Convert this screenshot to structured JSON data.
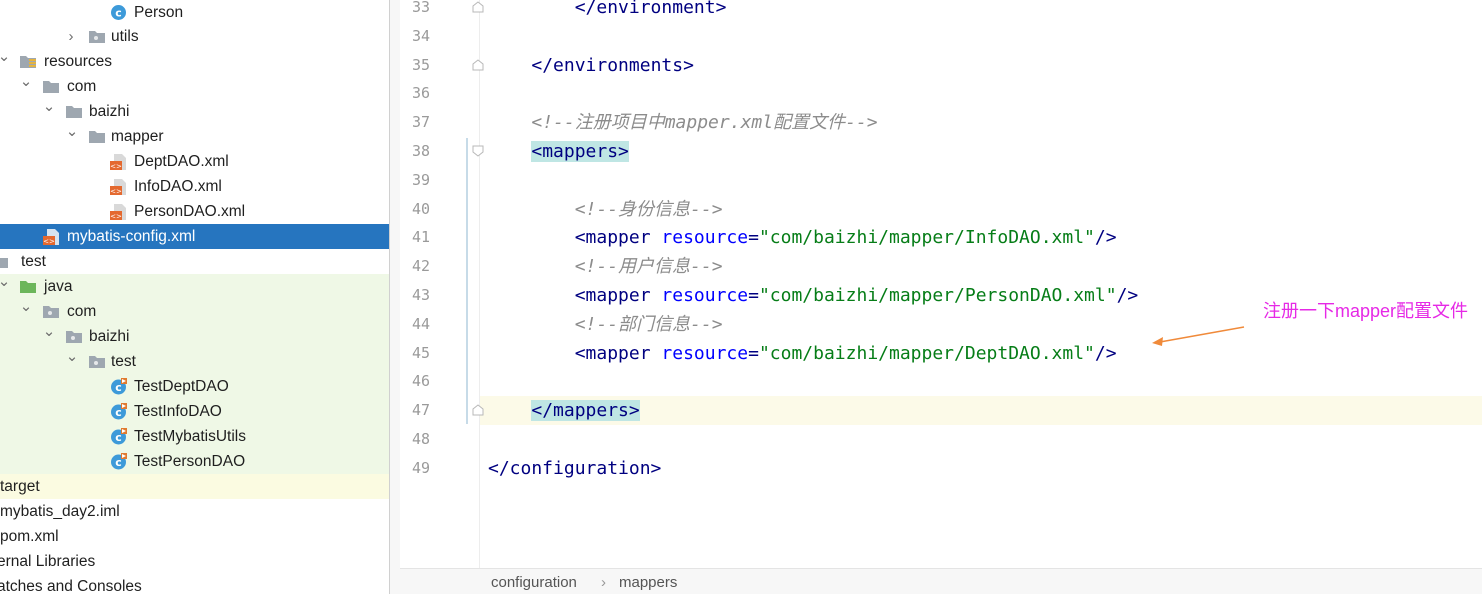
{
  "project_tree": {
    "items": [
      {
        "label": "Person",
        "icon": "class-icon"
      },
      {
        "label": "utils",
        "icon": "package-folder-icon"
      },
      {
        "label": "resources",
        "icon": "resources-folder-icon"
      },
      {
        "label": "com",
        "icon": "folder-icon"
      },
      {
        "label": "baizhi",
        "icon": "folder-icon"
      },
      {
        "label": "mapper",
        "icon": "folder-icon"
      },
      {
        "label": "DeptDAO.xml",
        "icon": "xml-file-icon"
      },
      {
        "label": "InfoDAO.xml",
        "icon": "xml-file-icon"
      },
      {
        "label": "PersonDAO.xml",
        "icon": "xml-file-icon"
      },
      {
        "label": "mybatis-config.xml",
        "icon": "xml-file-icon"
      },
      {
        "label": "test",
        "icon": "folder-icon"
      },
      {
        "label": "java",
        "icon": "test-sources-folder-icon"
      },
      {
        "label": "com",
        "icon": "package-folder-icon"
      },
      {
        "label": "baizhi",
        "icon": "package-folder-icon"
      },
      {
        "label": "test",
        "icon": "package-folder-icon"
      },
      {
        "label": "TestDeptDAO",
        "icon": "test-class-icon"
      },
      {
        "label": "TestInfoDAO",
        "icon": "test-class-icon"
      },
      {
        "label": "TestMybatisUtils",
        "icon": "test-class-icon"
      },
      {
        "label": "TestPersonDAO",
        "icon": "test-class-icon"
      },
      {
        "label": "target",
        "icon": "folder-icon"
      },
      {
        "label": "mybatis_day2.iml",
        "icon": "iml-file-icon"
      },
      {
        "label": "pom.xml",
        "icon": "maven-file-icon"
      },
      {
        "label": "ernal Libraries",
        "icon": "library-icon"
      },
      {
        "label": "atches and Consoles",
        "icon": "scratch-icon"
      }
    ]
  },
  "editor": {
    "lines": [
      {
        "num": "33",
        "tokens": [
          {
            "t": "        "
          },
          {
            "t": "</environment>",
            "c": "tag"
          }
        ]
      },
      {
        "num": "34",
        "tokens": []
      },
      {
        "num": "35",
        "tokens": [
          {
            "t": "    "
          },
          {
            "t": "</environments>",
            "c": "tag"
          }
        ]
      },
      {
        "num": "36",
        "tokens": []
      },
      {
        "num": "37",
        "tokens": [
          {
            "t": "    "
          },
          {
            "t": "<!--注册项目中mapper.xml配置文件-->",
            "c": "cmt"
          }
        ]
      },
      {
        "num": "38",
        "tokens": [
          {
            "t": "    "
          },
          {
            "t": "<mappers>",
            "c": "tag tagbox"
          }
        ]
      },
      {
        "num": "39",
        "tokens": []
      },
      {
        "num": "40",
        "tokens": [
          {
            "t": "        "
          },
          {
            "t": "<!--身份信息-->",
            "c": "cmt"
          }
        ]
      },
      {
        "num": "41",
        "tokens": [
          {
            "t": "        "
          },
          {
            "t": "<mapper",
            "c": "tag"
          },
          {
            "t": " "
          },
          {
            "t": "resource",
            "c": "attr"
          },
          {
            "t": "=",
            "c": "tag"
          },
          {
            "t": "\"com/baizhi/mapper/InfoDAO.xml\"",
            "c": "str"
          },
          {
            "t": "/>",
            "c": "tag"
          }
        ]
      },
      {
        "num": "42",
        "tokens": [
          {
            "t": "        "
          },
          {
            "t": "<!--用户信息-->",
            "c": "cmt"
          }
        ]
      },
      {
        "num": "43",
        "tokens": [
          {
            "t": "        "
          },
          {
            "t": "<mapper",
            "c": "tag"
          },
          {
            "t": " "
          },
          {
            "t": "resource",
            "c": "attr"
          },
          {
            "t": "=",
            "c": "tag"
          },
          {
            "t": "\"com/baizhi/mapper/PersonDAO.xml\"",
            "c": "str"
          },
          {
            "t": "/>",
            "c": "tag"
          }
        ]
      },
      {
        "num": "44",
        "tokens": [
          {
            "t": "        "
          },
          {
            "t": "<!--部门信息-->",
            "c": "cmt"
          }
        ]
      },
      {
        "num": "45",
        "tokens": [
          {
            "t": "        "
          },
          {
            "t": "<mapper",
            "c": "tag"
          },
          {
            "t": " "
          },
          {
            "t": "resource",
            "c": "attr"
          },
          {
            "t": "=",
            "c": "tag"
          },
          {
            "t": "\"com/baizhi/mapper/DeptDAO.xml\"",
            "c": "str"
          },
          {
            "t": "/>",
            "c": "tag"
          }
        ]
      },
      {
        "num": "46",
        "tokens": []
      },
      {
        "num": "47",
        "tokens": [
          {
            "t": "    "
          },
          {
            "t": "</mappers>",
            "c": "tag tagbox"
          }
        ]
      },
      {
        "num": "48",
        "tokens": []
      },
      {
        "num": "49",
        "tokens": [
          {
            "t": "</configuration>",
            "c": "tag"
          }
        ]
      }
    ]
  },
  "breadcrumb": {
    "items": [
      "configuration",
      "mappers"
    ],
    "separator": "›"
  },
  "annotation": {
    "text": "注册一下mapper配置文件",
    "color": "#e629e6"
  },
  "colors": {
    "selection": "#2675bf",
    "test_bg": "#eff8e6",
    "excluded_bg": "#fbfbe1",
    "tag_highlight": "#bfe6e4",
    "current_line": "#fcfae8"
  }
}
